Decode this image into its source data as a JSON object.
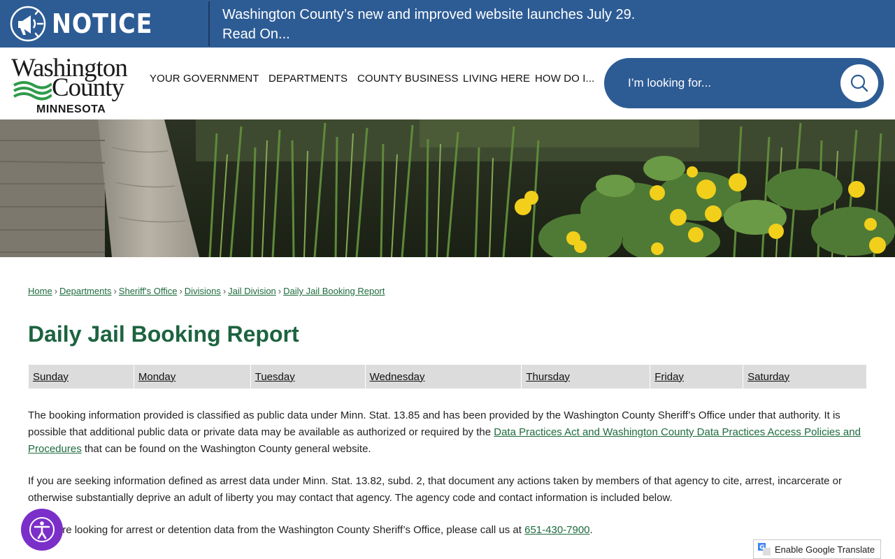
{
  "notice": {
    "label": "NOTICE",
    "line1": "Washington County’s new and improved website launches July 29.",
    "line2": "Read On..."
  },
  "logo": {
    "word1": "Washington",
    "word2": "County",
    "state": "MINNESOTA"
  },
  "nav": {
    "items": [
      "YOUR GOVERNMENT",
      "DEPARTMENTS",
      "COUNTY BUSINESS",
      "LIVING HERE",
      "HOW DO I..."
    ]
  },
  "search": {
    "placeholder": "I’m looking for..."
  },
  "breadcrumb": [
    "Home",
    "Departments",
    "Sheriff's Office",
    "Divisions",
    "Jail Division",
    "Daily Jail Booking Report"
  ],
  "page_title": "Daily Jail Booking Report",
  "days": [
    "Sunday",
    "Monday",
    "Tuesday",
    "Wednesday",
    "Thursday",
    "Friday",
    "Saturday"
  ],
  "paragraphs": {
    "p1_text1": "The booking information provided is classified as public data under Minn. Stat. 13.85 and has been provided by the Washington County Sheriff’s Office under that authority. It is possible that additional public data or private data may be available as authorized or required by the ",
    "p1_link": "Data Practices Act and Washington County Data Practices Access Policies and Procedures",
    "p1_text2": " that can be found on the Washington County general website.",
    "p2": "If you are seeking information defined as arrest data under Minn. Stat. 13.82, subd. 2, that document any actions taken by members of that agency to cite, arrest, incarcerate or otherwise substantially deprive an adult of liberty you may contact that agency. The agency code and contact information is included below.",
    "p3_text1": "If you are looking for arrest or detention data from the Washington County Sheriff’s Office, please call us at ",
    "p3_phone": "651-430-7900",
    "p3_text2": "."
  },
  "translate": {
    "label": "Enable Google Translate"
  },
  "colors": {
    "notice_bg": "#2d5c95",
    "title_green": "#1d6340",
    "link_green": "#1d6b3c",
    "a11y_purple": "#7b2fc9"
  }
}
